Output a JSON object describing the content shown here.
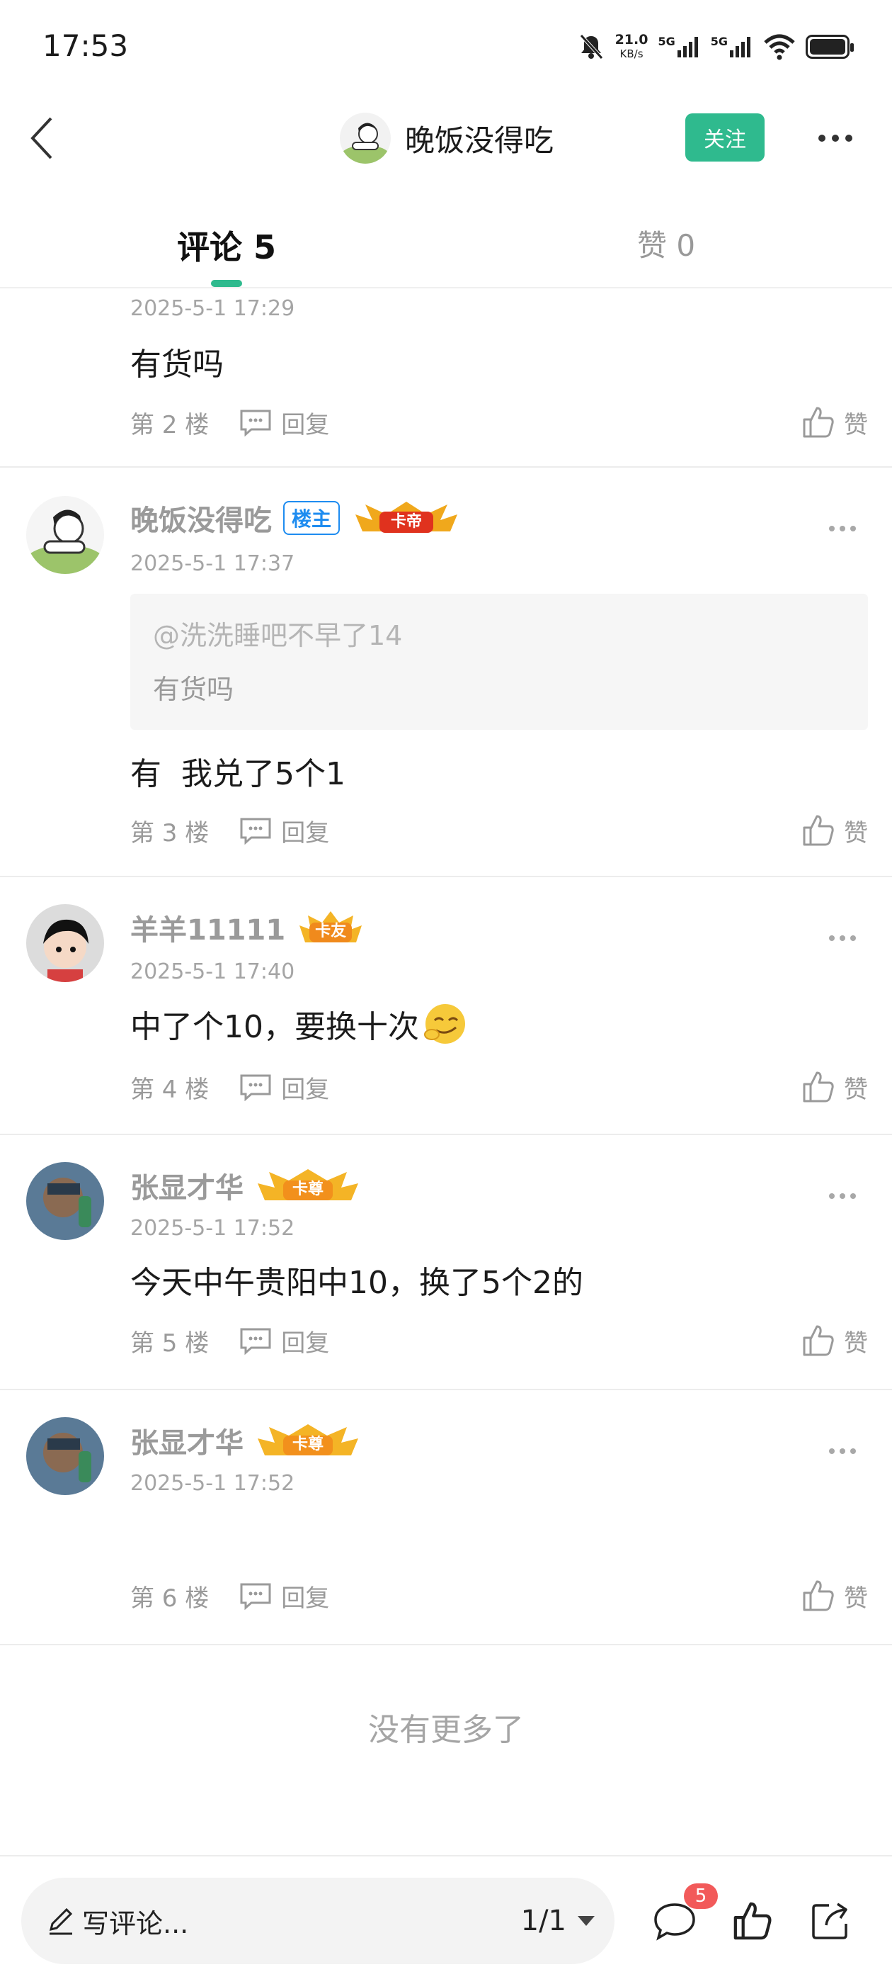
{
  "status_bar": {
    "time": "17:53",
    "net_speed_value": "21.0",
    "net_speed_unit": "KB/s",
    "signal1": "5G",
    "signal2": "5G"
  },
  "header": {
    "user_name": "晚饭没得吃",
    "follow_label": "关注"
  },
  "tabs": {
    "comments_label": "评论 5",
    "likes_label": "赞 0"
  },
  "comments": [
    {
      "time": "2025-5-1 17:29",
      "text": "有货吗",
      "floor": "第 2 楼",
      "reply": "回复",
      "like": "赞"
    },
    {
      "name": "晚饭没得吃",
      "owner_tag": "楼主",
      "crown": "卡帝",
      "time": "2025-5-1 17:37",
      "quote_user": "@洗洗睡吧不早了14",
      "quote_text": "有货吗",
      "text": "有  我兑了5个1",
      "floor": "第 3 楼",
      "reply": "回复",
      "like": "赞"
    },
    {
      "name": "羊羊11111",
      "crown": "卡友",
      "time": "2025-5-1 17:40",
      "text": "中了个10，要换十次",
      "floor": "第 4 楼",
      "reply": "回复",
      "like": "赞"
    },
    {
      "name": "张显才华",
      "crown": "卡尊",
      "time": "2025-5-1 17:52",
      "text": "今天中午贵阳中10，换了5个2的",
      "floor": "第 5 楼",
      "reply": "回复",
      "like": "赞"
    },
    {
      "name": "张显才华",
      "crown": "卡尊",
      "time": "2025-5-1 17:52",
      "text": "",
      "floor": "第 6 楼",
      "reply": "回复",
      "like": "赞"
    }
  ],
  "footer_note": "没有更多了",
  "bottom_bar": {
    "input_placeholder": "写评论...",
    "page_indicator": "1/1",
    "comment_badge": "5"
  },
  "colors": {
    "accent": "#2fba8e",
    "owner_tag": "#1e8cf0",
    "badge": "#f25a5a"
  }
}
